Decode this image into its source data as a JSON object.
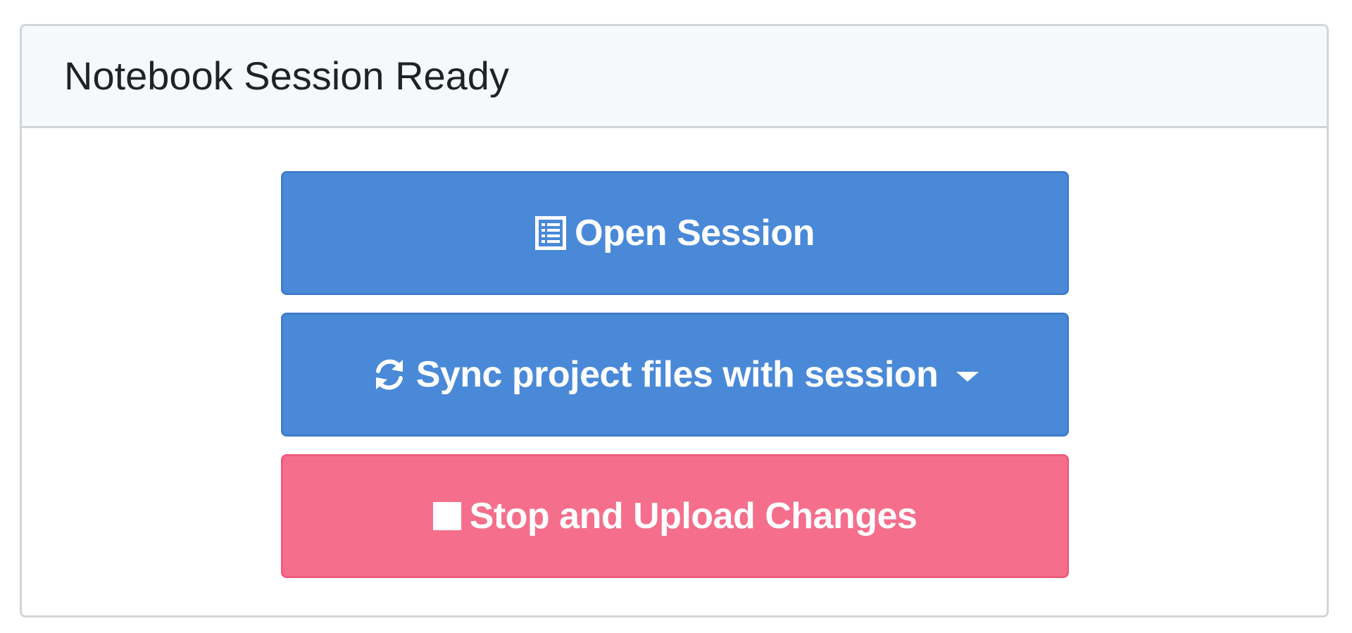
{
  "card": {
    "title": "Notebook Session Ready"
  },
  "buttons": {
    "open": {
      "label": "Open Session",
      "icon": "list-alt-icon"
    },
    "sync": {
      "label": "Sync project files with session",
      "icon": "refresh-icon",
      "dropdown_icon": "caret-down-icon"
    },
    "stop": {
      "label": "Stop and Upload Changes",
      "icon": "stop-icon"
    }
  },
  "colors": {
    "primary": "#4a89d8",
    "danger": "#f56f8c",
    "header_bg": "#f7f8fa",
    "border": "#d1d5da"
  }
}
